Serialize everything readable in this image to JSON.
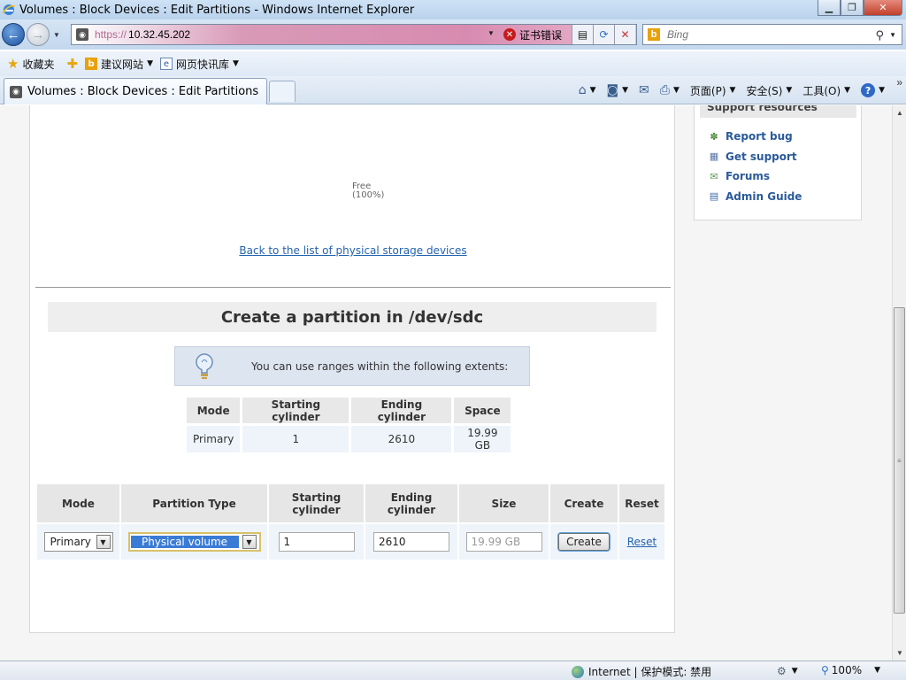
{
  "window": {
    "title": "Volumes : Block Devices : Edit Partitions - Windows Internet Explorer",
    "min_glyph": "▁",
    "max_glyph": "❐",
    "close_glyph": "✕"
  },
  "addressbar": {
    "scheme": "https://",
    "host": "10.32.45.202",
    "cert_error": "证书错误",
    "search_placeholder": "Bing"
  },
  "favorites": {
    "favorites_label": "收藏夹",
    "suggested_sites": "建议网站",
    "web_slice_gallery": "网页快讯库"
  },
  "tab": {
    "label": "Volumes : Block Devices : Edit Partitions"
  },
  "commandbar": {
    "page": "页面(P)",
    "safety": "安全(S)",
    "tools": "工具(O)",
    "help": "?"
  },
  "content": {
    "chart": {
      "free_label": "Free",
      "free_percent": "(100%)"
    },
    "back_link": "Back to the list of physical storage devices",
    "section_title": "Create a partition in /dev/sdc",
    "hint": "You can use ranges within the following extents:",
    "extents": {
      "headers": [
        "Mode",
        "Starting cylinder",
        "Ending cylinder",
        "Space"
      ],
      "rows": [
        [
          "Primary",
          "1",
          "2610",
          "19.99 GB"
        ]
      ]
    },
    "form": {
      "headers": [
        "Mode",
        "Partition Type",
        "Starting\ncylinder",
        "Ending\ncylinder",
        "Size",
        "Create",
        "Reset"
      ],
      "mode_value": "Primary",
      "partition_type_value": "Physical volume",
      "start_value": "1",
      "end_value": "2610",
      "size_placeholder": "19.99 GB",
      "create_label": "Create",
      "reset_label": "Reset"
    }
  },
  "sidebar": {
    "header": "Support resources",
    "links": [
      {
        "label": "Report bug",
        "icon": "bug-icon"
      },
      {
        "label": "Get support",
        "icon": "support-icon"
      },
      {
        "label": "Forums",
        "icon": "forums-icon"
      },
      {
        "label": "Admin Guide",
        "icon": "book-icon"
      }
    ]
  },
  "statusbar": {
    "zone": "Internet | 保护模式: 禁用",
    "zoom": "100%"
  }
}
